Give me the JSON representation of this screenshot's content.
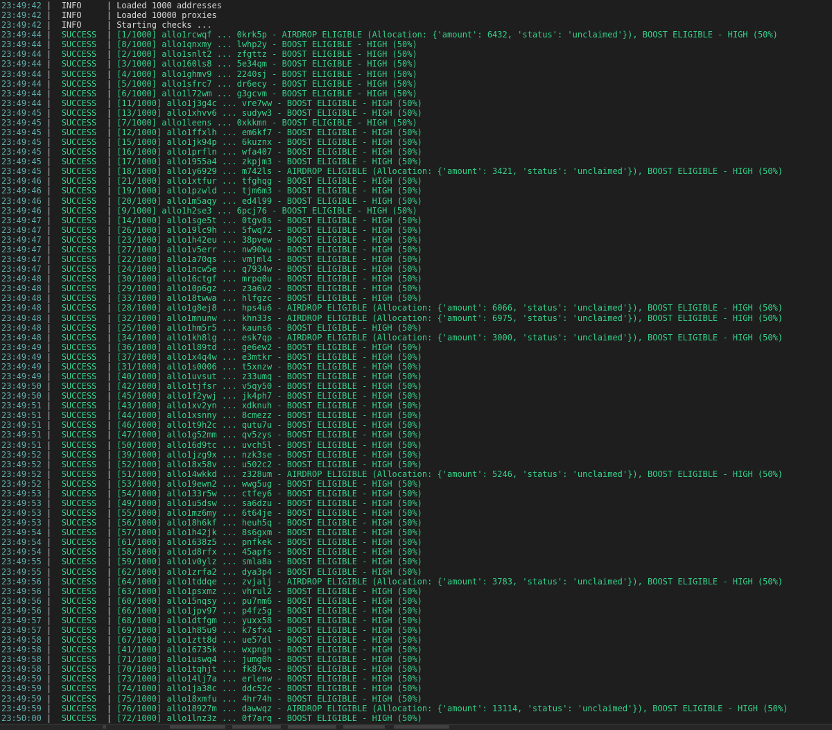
{
  "log": [
    {
      "time": "23:49:42",
      "level": "INFO",
      "msg": "Loaded 1000 addresses"
    },
    {
      "time": "23:49:42",
      "level": "INFO",
      "msg": "Loaded 10000 proxies"
    },
    {
      "time": "23:49:42",
      "level": "INFO",
      "msg": "Starting checks ..."
    },
    {
      "time": "23:49:44",
      "level": "SUCCESS",
      "msg": "[1/1000] allo1rcwqf ... 0krk5p - AIRDROP ELIGIBLE (Allocation: {'amount': 6432, 'status': 'unclaimed'}), BOOST ELIGIBLE - HIGH (50%)"
    },
    {
      "time": "23:49:44",
      "level": "SUCCESS",
      "msg": "[8/1000] allo1qnxmy ... lwhp2y - BOOST ELIGIBLE - HIGH (50%)"
    },
    {
      "time": "23:49:44",
      "level": "SUCCESS",
      "msg": "[2/1000] allo1snlt2 ... zfgttz - BOOST ELIGIBLE - HIGH (50%)"
    },
    {
      "time": "23:49:44",
      "level": "SUCCESS",
      "msg": "[3/1000] allo160ls8 ... 5e34qm - BOOST ELIGIBLE - HIGH (50%)"
    },
    {
      "time": "23:49:44",
      "level": "SUCCESS",
      "msg": "[4/1000] allo1ghmv9 ... 2240sj - BOOST ELIGIBLE - HIGH (50%)"
    },
    {
      "time": "23:49:44",
      "level": "SUCCESS",
      "msg": "[5/1000] allo1sfrc7 ... dr6ecy - BOOST ELIGIBLE - HIGH (50%)"
    },
    {
      "time": "23:49:44",
      "level": "SUCCESS",
      "msg": "[6/1000] allo1l72wm ... g3gcvm - BOOST ELIGIBLE - HIGH (50%)"
    },
    {
      "time": "23:49:44",
      "level": "SUCCESS",
      "msg": "[11/1000] allo1j3g4c ... vre7ww - BOOST ELIGIBLE - HIGH (50%)"
    },
    {
      "time": "23:49:45",
      "level": "SUCCESS",
      "msg": "[13/1000] allo1xhvv6 ... sudyw3 - BOOST ELIGIBLE - HIGH (50%)"
    },
    {
      "time": "23:49:45",
      "level": "SUCCESS",
      "msg": "[7/1000] allo1leens ... 0xkkmn - BOOST ELIGIBLE - HIGH (50%)"
    },
    {
      "time": "23:49:45",
      "level": "SUCCESS",
      "msg": "[12/1000] allo1ffxlh ... em6kf7 - BOOST ELIGIBLE - HIGH (50%)"
    },
    {
      "time": "23:49:45",
      "level": "SUCCESS",
      "msg": "[15/1000] allo1jk94p ... 6kuznx - BOOST ELIGIBLE - HIGH (50%)"
    },
    {
      "time": "23:49:45",
      "level": "SUCCESS",
      "msg": "[16/1000] allo1prfln ... wfa407 - BOOST ELIGIBLE - HIGH (50%)"
    },
    {
      "time": "23:49:45",
      "level": "SUCCESS",
      "msg": "[17/1000] allo1955a4 ... zkpjm3 - BOOST ELIGIBLE - HIGH (50%)"
    },
    {
      "time": "23:49:45",
      "level": "SUCCESS",
      "msg": "[18/1000] allo1y6929 ... m742ls - AIRDROP ELIGIBLE (Allocation: {'amount': 3421, 'status': 'unclaimed'}), BOOST ELIGIBLE - HIGH (50%)"
    },
    {
      "time": "23:49:46",
      "level": "SUCCESS",
      "msg": "[21/1000] allo1xtfur ... tfghqg - BOOST ELIGIBLE - HIGH (50%)"
    },
    {
      "time": "23:49:46",
      "level": "SUCCESS",
      "msg": "[19/1000] allo1pzwld ... tjm6m3 - BOOST ELIGIBLE - HIGH (50%)"
    },
    {
      "time": "23:49:46",
      "level": "SUCCESS",
      "msg": "[20/1000] allo1m5aqy ... ed4l99 - BOOST ELIGIBLE - HIGH (50%)"
    },
    {
      "time": "23:49:46",
      "level": "SUCCESS",
      "msg": "[9/1000] allo1h2se3 ... 6pcj76 - BOOST ELIGIBLE - HIGH (50%)"
    },
    {
      "time": "23:49:47",
      "level": "SUCCESS",
      "msg": "[14/1000] allo1sge5t ... 0tgv8s - BOOST ELIGIBLE - HIGH (50%)"
    },
    {
      "time": "23:49:47",
      "level": "SUCCESS",
      "msg": "[26/1000] allo19lc9h ... 5fwq72 - BOOST ELIGIBLE - HIGH (50%)"
    },
    {
      "time": "23:49:47",
      "level": "SUCCESS",
      "msg": "[23/1000] allo1h42eu ... 38pvew - BOOST ELIGIBLE - HIGH (50%)"
    },
    {
      "time": "23:49:47",
      "level": "SUCCESS",
      "msg": "[27/1000] allo1v5err ... nw90wu - BOOST ELIGIBLE - HIGH (50%)"
    },
    {
      "time": "23:49:47",
      "level": "SUCCESS",
      "msg": "[22/1000] allo1a70qs ... vmjml4 - BOOST ELIGIBLE - HIGH (50%)"
    },
    {
      "time": "23:49:47",
      "level": "SUCCESS",
      "msg": "[24/1000] allo1ncw5e ... q7934w - BOOST ELIGIBLE - HIGH (50%)"
    },
    {
      "time": "23:49:48",
      "level": "SUCCESS",
      "msg": "[30/1000] allo16ctgf ... mrpq0u - BOOST ELIGIBLE - HIGH (50%)"
    },
    {
      "time": "23:49:48",
      "level": "SUCCESS",
      "msg": "[29/1000] allo10p6gz ... z3a6v2 - BOOST ELIGIBLE - HIGH (50%)"
    },
    {
      "time": "23:49:48",
      "level": "SUCCESS",
      "msg": "[33/1000] allo18twwa ... hlfgzc - BOOST ELIGIBLE - HIGH (50%)"
    },
    {
      "time": "23:49:48",
      "level": "SUCCESS",
      "msg": "[28/1000] allo1g8ej8 ... hps4u6 - AIRDROP ELIGIBLE (Allocation: {'amount': 6066, 'status': 'unclaimed'}), BOOST ELIGIBLE - HIGH (50%)"
    },
    {
      "time": "23:49:48",
      "level": "SUCCESS",
      "msg": "[32/1000] allo1mnunw ... khn33s - AIRDROP ELIGIBLE (Allocation: {'amount': 6975, 'status': 'unclaimed'}), BOOST ELIGIBLE - HIGH (50%)"
    },
    {
      "time": "23:49:48",
      "level": "SUCCESS",
      "msg": "[25/1000] allo1hm5r5 ... kauns6 - BOOST ELIGIBLE - HIGH (50%)"
    },
    {
      "time": "23:49:48",
      "level": "SUCCESS",
      "msg": "[34/1000] allo1kh8lg ... esk7qp - AIRDROP ELIGIBLE (Allocation: {'amount': 3000, 'status': 'unclaimed'}), BOOST ELIGIBLE - HIGH (50%)"
    },
    {
      "time": "23:49:49",
      "level": "SUCCESS",
      "msg": "[36/1000] allo1l89td ... ge6ew2 - BOOST ELIGIBLE - HIGH (50%)"
    },
    {
      "time": "23:49:49",
      "level": "SUCCESS",
      "msg": "[37/1000] allo1x4q4w ... e3mtkr - BOOST ELIGIBLE - HIGH (50%)"
    },
    {
      "time": "23:49:49",
      "level": "SUCCESS",
      "msg": "[31/1000] allo1s0006 ... t5xnzw - BOOST ELIGIBLE - HIGH (50%)"
    },
    {
      "time": "23:49:49",
      "level": "SUCCESS",
      "msg": "[40/1000] allo1uvsut ... z33umq - BOOST ELIGIBLE - HIGH (50%)"
    },
    {
      "time": "23:49:50",
      "level": "SUCCESS",
      "msg": "[42/1000] allo1tjfsr ... v5qy50 - BOOST ELIGIBLE - HIGH (50%)"
    },
    {
      "time": "23:49:50",
      "level": "SUCCESS",
      "msg": "[45/1000] allo1f2ywj ... jk4ph7 - BOOST ELIGIBLE - HIGH (50%)"
    },
    {
      "time": "23:49:51",
      "level": "SUCCESS",
      "msg": "[43/1000] allo1xv2yn ... xdknuh - BOOST ELIGIBLE - HIGH (50%)"
    },
    {
      "time": "23:49:51",
      "level": "SUCCESS",
      "msg": "[44/1000] allo1xsnny ... 8cmezz - BOOST ELIGIBLE - HIGH (50%)"
    },
    {
      "time": "23:49:51",
      "level": "SUCCESS",
      "msg": "[46/1000] allo1t9h2c ... qutu7u - BOOST ELIGIBLE - HIGH (50%)"
    },
    {
      "time": "23:49:51",
      "level": "SUCCESS",
      "msg": "[47/1000] allo1g52mm ... qv5zys - BOOST ELIGIBLE - HIGH (50%)"
    },
    {
      "time": "23:49:51",
      "level": "SUCCESS",
      "msg": "[50/1000] allo16d9tc ... uvch5l - BOOST ELIGIBLE - HIGH (50%)"
    },
    {
      "time": "23:49:52",
      "level": "SUCCESS",
      "msg": "[39/1000] allo1jzg9x ... nzk3se - BOOST ELIGIBLE - HIGH (50%)"
    },
    {
      "time": "23:49:52",
      "level": "SUCCESS",
      "msg": "[52/1000] allo18x58v ... u502c2 - BOOST ELIGIBLE - HIGH (50%)"
    },
    {
      "time": "23:49:52",
      "level": "SUCCESS",
      "msg": "[51/1000] allo14wkkd ... z328um - AIRDROP ELIGIBLE (Allocation: {'amount': 5246, 'status': 'unclaimed'}), BOOST ELIGIBLE - HIGH (50%)"
    },
    {
      "time": "23:49:52",
      "level": "SUCCESS",
      "msg": "[53/1000] allo19ewn2 ... wwg5ug - BOOST ELIGIBLE - HIGH (50%)"
    },
    {
      "time": "23:49:53",
      "level": "SUCCESS",
      "msg": "[54/1000] allo133r5w ... ctfey6 - BOOST ELIGIBLE - HIGH (50%)"
    },
    {
      "time": "23:49:53",
      "level": "SUCCESS",
      "msg": "[49/1000] allo1u5dsw ... sa6dzu - BOOST ELIGIBLE - HIGH (50%)"
    },
    {
      "time": "23:49:53",
      "level": "SUCCESS",
      "msg": "[55/1000] allo1mz6my ... 6t64je - BOOST ELIGIBLE - HIGH (50%)"
    },
    {
      "time": "23:49:53",
      "level": "SUCCESS",
      "msg": "[56/1000] allo18h6kf ... heuh5q - BOOST ELIGIBLE - HIGH (50%)"
    },
    {
      "time": "23:49:54",
      "level": "SUCCESS",
      "msg": "[57/1000] allo1h42jk ... 8s6gxm - BOOST ELIGIBLE - HIGH (50%)"
    },
    {
      "time": "23:49:54",
      "level": "SUCCESS",
      "msg": "[61/1000] allo1638z5 ... pnfkek - BOOST ELIGIBLE - HIGH (50%)"
    },
    {
      "time": "23:49:54",
      "level": "SUCCESS",
      "msg": "[58/1000] allo1d8rfx ... 45apfs - BOOST ELIGIBLE - HIGH (50%)"
    },
    {
      "time": "23:49:55",
      "level": "SUCCESS",
      "msg": "[59/1000] allo1v0ylz ... smla8a - BOOST ELIGIBLE - HIGH (50%)"
    },
    {
      "time": "23:49:55",
      "level": "SUCCESS",
      "msg": "[62/1000] allo1zrfa2 ... dya3p4 - BOOST ELIGIBLE - HIGH (50%)"
    },
    {
      "time": "23:49:56",
      "level": "SUCCESS",
      "msg": "[64/1000] allo1tddqe ... zvjalj - AIRDROP ELIGIBLE (Allocation: {'amount': 3783, 'status': 'unclaimed'}), BOOST ELIGIBLE - HIGH (50%)"
    },
    {
      "time": "23:49:56",
      "level": "SUCCESS",
      "msg": "[63/1000] allo1psxmz ... vhrul2 - BOOST ELIGIBLE - HIGH (50%)"
    },
    {
      "time": "23:49:56",
      "level": "SUCCESS",
      "msg": "[60/1000] allo15nqsy ... pu7nm6 - BOOST ELIGIBLE - HIGH (50%)"
    },
    {
      "time": "23:49:56",
      "level": "SUCCESS",
      "msg": "[66/1000] allo1jpv97 ... p4fz5g - BOOST ELIGIBLE - HIGH (50%)"
    },
    {
      "time": "23:49:57",
      "level": "SUCCESS",
      "msg": "[68/1000] allo1dtfgm ... yuxx58 - BOOST ELIGIBLE - HIGH (50%)"
    },
    {
      "time": "23:49:57",
      "level": "SUCCESS",
      "msg": "[69/1000] allo1h85u9 ... k7sfx4 - BOOST ELIGIBLE - HIGH (50%)"
    },
    {
      "time": "23:49:58",
      "level": "SUCCESS",
      "msg": "[67/1000] allo1ztt8d ... ue57dl - BOOST ELIGIBLE - HIGH (50%)"
    },
    {
      "time": "23:49:58",
      "level": "SUCCESS",
      "msg": "[41/1000] allo16735k ... wxpngn - BOOST ELIGIBLE - HIGH (50%)"
    },
    {
      "time": "23:49:58",
      "level": "SUCCESS",
      "msg": "[71/1000] allo1uswq4 ... jumg0h - BOOST ELIGIBLE - HIGH (50%)"
    },
    {
      "time": "23:49:58",
      "level": "SUCCESS",
      "msg": "[70/1000] allo1tqhjt ... fk87ws - BOOST ELIGIBLE - HIGH (50%)"
    },
    {
      "time": "23:49:59",
      "level": "SUCCESS",
      "msg": "[73/1000] allo14lj7a ... erlenw - BOOST ELIGIBLE - HIGH (50%)"
    },
    {
      "time": "23:49:59",
      "level": "SUCCESS",
      "msg": "[74/1000] allo1ja38c ... ddc52c - BOOST ELIGIBLE - HIGH (50%)"
    },
    {
      "time": "23:49:59",
      "level": "SUCCESS",
      "msg": "[75/1000] allo18xmfu ... 4hr74h - BOOST ELIGIBLE - HIGH (50%)"
    },
    {
      "time": "23:49:59",
      "level": "SUCCESS",
      "msg": "[76/1000] allo18927m ... dawwqz - AIRDROP ELIGIBLE (Allocation: {'amount': 13114, 'status': 'unclaimed'}), BOOST ELIGIBLE - HIGH (50%)"
    },
    {
      "time": "23:50:00",
      "level": "SUCCESS",
      "msg": "[72/1000] allo1lnz3z ... 0f7arq - BOOST ELIGIBLE - HIGH (50%)"
    }
  ],
  "colors": {
    "background": "#1e1e1e",
    "timestamp": "#5fb0ad",
    "info": "#d8d8d8",
    "success": "#35d18a"
  }
}
